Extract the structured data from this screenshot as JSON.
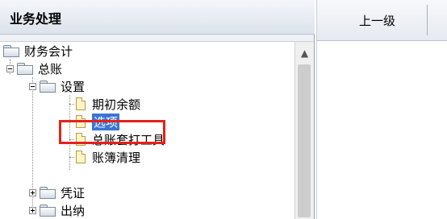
{
  "left_panel": {
    "title": "业务处理",
    "tree": {
      "root": "财务会计",
      "ledger": "总账",
      "settings": "设置",
      "opening_balance": "期初余额",
      "options": "选项",
      "ledger_toolkit": "总账套打工具",
      "book_cleanup": "账簿清理",
      "voucher": "凭证",
      "cashier": "出纳"
    }
  },
  "right_panel": {
    "column_header": "上一级"
  },
  "icons": {
    "folder": "folder-icon",
    "document": "document-icon",
    "expand": "plus-box-icon",
    "collapse": "minus-box-icon",
    "scroll_up": "chevron-up-icon"
  },
  "colors": {
    "selection": "#3a74d6",
    "highlight_box": "#e4221b"
  }
}
